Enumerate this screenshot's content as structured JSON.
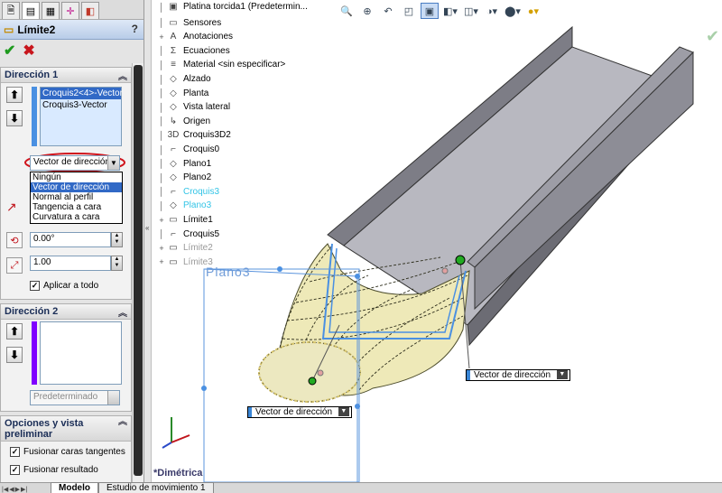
{
  "feature": {
    "title": "Límite2",
    "help": "?"
  },
  "actions": {
    "ok": "✔",
    "cancel": "✖"
  },
  "direction1": {
    "header": "Dirección 1",
    "selections": [
      "Croquis2<4>-Vector",
      "Croquis3-Vector"
    ],
    "condition_selected": "Vector de dirección",
    "condition_options": [
      "Ningún",
      "Vector de dirección",
      "Normal al perfil",
      "Tangencia a cara",
      "Curvatura a cara"
    ],
    "angle": "0.00°",
    "length": "1.00",
    "apply_all": "Aplicar a todo"
  },
  "direction2": {
    "header": "Dirección 2",
    "condition_placeholder": "Predeterminado"
  },
  "options": {
    "header": "Opciones y vista preliminar",
    "merge_tangent": "Fusionar caras tangentes",
    "merge_result": "Fusionar resultado"
  },
  "feature_tree": [
    {
      "label": "Platina torcida1  (Predetermin...",
      "state": "normal",
      "expander": "",
      "icon": "part-icon"
    },
    {
      "label": "Sensores",
      "state": "normal",
      "expander": "",
      "icon": "folder-icon"
    },
    {
      "label": "Anotaciones",
      "state": "normal",
      "expander": "+",
      "icon": "annotation-icon"
    },
    {
      "label": "Ecuaciones",
      "state": "normal",
      "expander": "",
      "icon": "equation-icon"
    },
    {
      "label": "Material <sin especificar>",
      "state": "normal",
      "expander": "",
      "icon": "material-icon"
    },
    {
      "label": "Alzado",
      "state": "normal",
      "expander": "",
      "icon": "plane-icon"
    },
    {
      "label": "Planta",
      "state": "normal",
      "expander": "",
      "icon": "plane-icon"
    },
    {
      "label": "Vista lateral",
      "state": "normal",
      "expander": "",
      "icon": "plane-icon"
    },
    {
      "label": "Origen",
      "state": "normal",
      "expander": "",
      "icon": "origin-icon"
    },
    {
      "label": "Croquis3D2",
      "state": "normal",
      "expander": "",
      "icon": "sketch3d-icon"
    },
    {
      "label": "Croquis0",
      "state": "normal",
      "expander": "",
      "icon": "sketch-icon"
    },
    {
      "label": "Plano1",
      "state": "normal",
      "expander": "",
      "icon": "plane-icon"
    },
    {
      "label": "Plano2",
      "state": "normal",
      "expander": "",
      "icon": "plane-icon"
    },
    {
      "label": "Croquis3",
      "state": "cyan",
      "expander": "",
      "icon": "sketch-icon"
    },
    {
      "label": "Plano3",
      "state": "cyan",
      "expander": "",
      "icon": "plane-icon"
    },
    {
      "label": "Límite1",
      "state": "normal",
      "expander": "+",
      "icon": "boundary-icon"
    },
    {
      "label": "Croquis5",
      "state": "normal",
      "expander": "",
      "icon": "sketch-icon"
    },
    {
      "label": "Límite2",
      "state": "dim",
      "expander": "+",
      "icon": "boundary-icon"
    },
    {
      "label": "Límite3",
      "state": "dim",
      "expander": "+",
      "icon": "boundary-icon"
    }
  ],
  "graphics": {
    "plane_label": "Plano3",
    "callout_right": "Vector de dirección",
    "callout_left": "Vector de dirección",
    "view_label": "*Dimétrica"
  },
  "bottom_tabs": [
    "Modelo",
    "Estudio de movimiento 1"
  ],
  "colors": {
    "accent": "#3169c6",
    "profile": "#4a90e2",
    "selection": "#8000ff"
  }
}
